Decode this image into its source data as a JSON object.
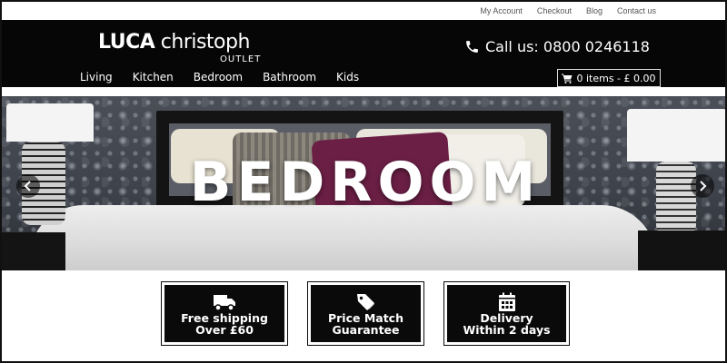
{
  "top_links": [
    "My Account",
    "Checkout",
    "Blog",
    "Contact us"
  ],
  "logo": {
    "main_bold": "LUCA",
    "main_rest": " christoph",
    "sub": "OUTLET"
  },
  "header": {
    "call_text": "Call us: 0800 0246118",
    "cart_text": "0 items - £ 0.00"
  },
  "nav": [
    "Living",
    "Kitchen",
    "Bedroom",
    "Bathroom",
    "Kids"
  ],
  "hero": {
    "title": "BEDROOM"
  },
  "features": [
    {
      "line1": "Free shipping",
      "line2": "Over £60",
      "icon": "truck-icon"
    },
    {
      "line1": "Price Match",
      "line2": "Guarantee",
      "icon": "tags-icon"
    },
    {
      "line1": "Delivery",
      "line2": "Within 2 days",
      "icon": "calendar-icon"
    }
  ],
  "colors": {
    "header_bg": "#060606",
    "feature_bg": "#0a0a0a",
    "text_light": "#ffffff"
  }
}
